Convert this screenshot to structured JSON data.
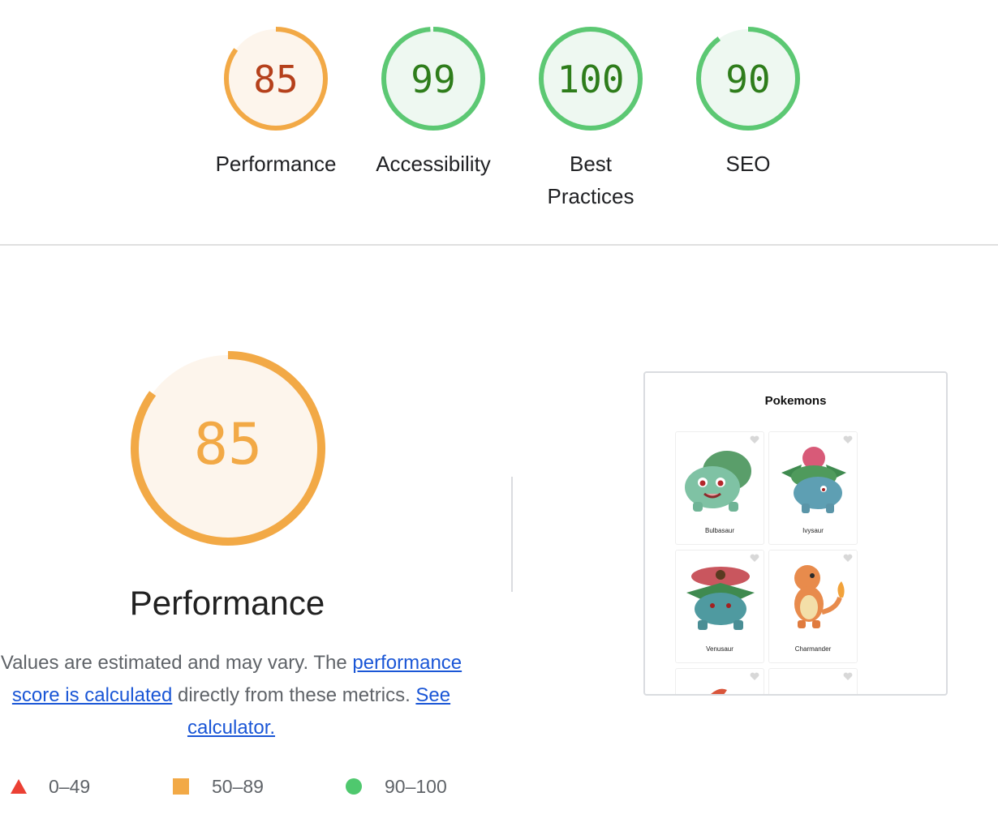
{
  "scores": [
    {
      "value": "85",
      "label": "Performance",
      "score": 85,
      "status": "average"
    },
    {
      "value": "99",
      "label": "Accessibility",
      "score": 99,
      "status": "pass"
    },
    {
      "value": "100",
      "label": "Best Practices",
      "score": 100,
      "status": "pass"
    },
    {
      "value": "90",
      "label": "SEO",
      "score": 90,
      "status": "pass"
    }
  ],
  "performance": {
    "score": "85",
    "title": "Performance",
    "desc_prefix": "Values are estimated and may vary. The ",
    "link_score": "performance score is calculated",
    "desc_mid": " directly from these metrics. ",
    "link_calculator": "See calculator."
  },
  "legend": [
    {
      "range": "0–49",
      "shape": "triangle",
      "color": "#eb4034"
    },
    {
      "range": "50–89",
      "shape": "square",
      "color": "#f2a946"
    },
    {
      "range": "90–100",
      "shape": "circle",
      "color": "#4fc86e"
    }
  ],
  "screenshot": {
    "title": "Pokemons",
    "cards": [
      "Bulbasaur",
      "Ivysaur",
      "Venusaur",
      "Charmander"
    ]
  },
  "colors": {
    "average_stroke": "#f2a946",
    "average_fill": "#fdf5ec",
    "average_text": "#b5401b",
    "pass_stroke": "#5cc873",
    "pass_fill": "#eef8f1",
    "pass_text": "#2e7d1b",
    "link": "#1a56d6"
  }
}
